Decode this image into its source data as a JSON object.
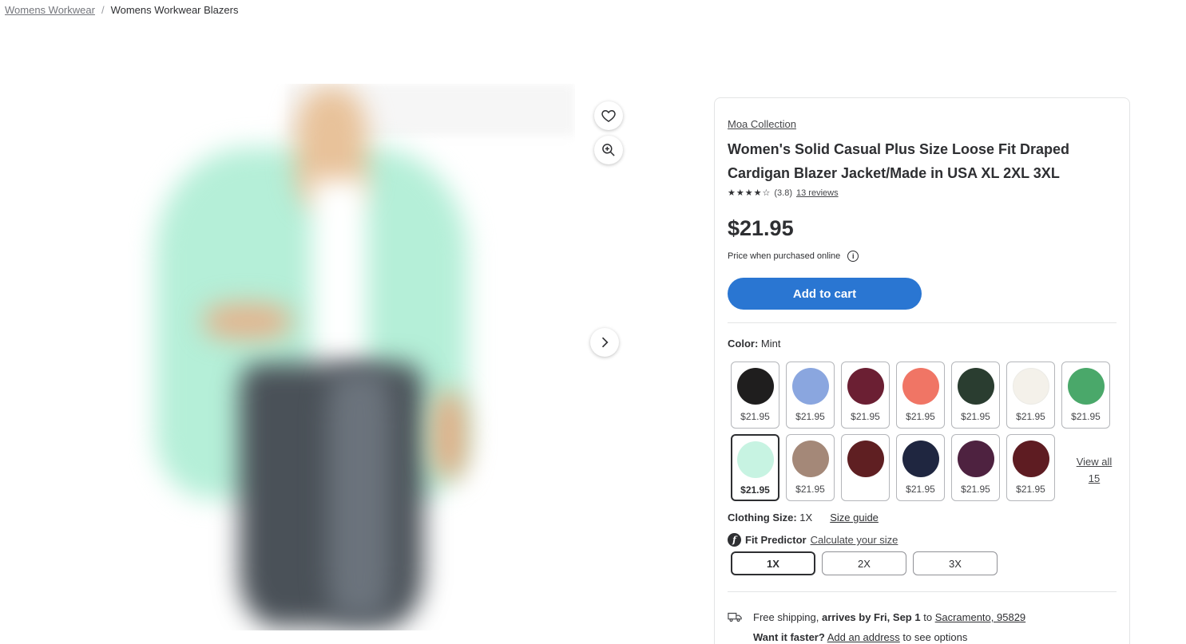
{
  "breadcrumb": {
    "items": [
      "Womens Workwear",
      "Womens Workwear Blazers"
    ],
    "separator": "/"
  },
  "gallery": {
    "favorite_icon": "heart-icon",
    "zoom_icon": "zoom-in-icon",
    "next_icon": "chevron-right-icon"
  },
  "product": {
    "brand": "Moa Collection",
    "title": "Women's Solid Casual Plus Size Loose Fit Draped Cardigan Blazer Jacket/Made in USA XL 2XL 3XL",
    "rating_value": 3.8,
    "rating_text": "(3.8)",
    "reviews_text": "13 reviews",
    "price": "$21.95",
    "price_note": "Price when purchased online",
    "info_icon": "info-icon",
    "add_to_cart": "Add to cart"
  },
  "color": {
    "label": "Color:",
    "selected": "Mint",
    "view_all": "View all 15",
    "swatches": [
      {
        "name": "Black",
        "hex": "#1f1e1e",
        "price": "$21.95"
      },
      {
        "name": "Light Blue",
        "hex": "#8aa6df",
        "price": "$21.95"
      },
      {
        "name": "Burgundy",
        "hex": "#6b1f33",
        "price": "$21.95"
      },
      {
        "name": "Coral",
        "hex": "#f07565",
        "price": "$21.95"
      },
      {
        "name": "Dark Green",
        "hex": "#2a3d30",
        "price": "$21.95"
      },
      {
        "name": "Ivory",
        "hex": "#f4f1ea",
        "price": "$21.95"
      },
      {
        "name": "Green",
        "hex": "#4aa86a",
        "price": "$21.95"
      },
      {
        "name": "Mint",
        "hex": "#c7f3e2",
        "price": "$21.95",
        "selected": true
      },
      {
        "name": "Taupe",
        "hex": "#a48878",
        "price": "$21.95"
      },
      {
        "name": "Wine",
        "hex": "#5f1f22",
        "price": ""
      },
      {
        "name": "Navy",
        "hex": "#1f2640",
        "price": "$21.95"
      },
      {
        "name": "Plum",
        "hex": "#4e2240",
        "price": "$21.95"
      },
      {
        "name": "Maroon",
        "hex": "#5e1c22",
        "price": "$21.95"
      }
    ]
  },
  "size": {
    "label": "Clothing Size:",
    "selected": "1X",
    "guide": "Size guide",
    "fit_logo": "f",
    "fit_predictor": "Fit Predictor",
    "calculate": "Calculate your size",
    "options": [
      "1X",
      "2X",
      "3X"
    ]
  },
  "shipping": {
    "icon": "truck-icon",
    "prefix": "Free shipping,",
    "arrives": "arrives by Fri, Sep 1",
    "to": "to",
    "location": "Sacramento, 95829",
    "faster_label": "Want it faster?",
    "add_address": "Add an address",
    "suffix": "to see options"
  },
  "colors": {
    "primary_button": "#2a76d2",
    "text": "#2e2f32",
    "border": "#e3e4e5"
  }
}
